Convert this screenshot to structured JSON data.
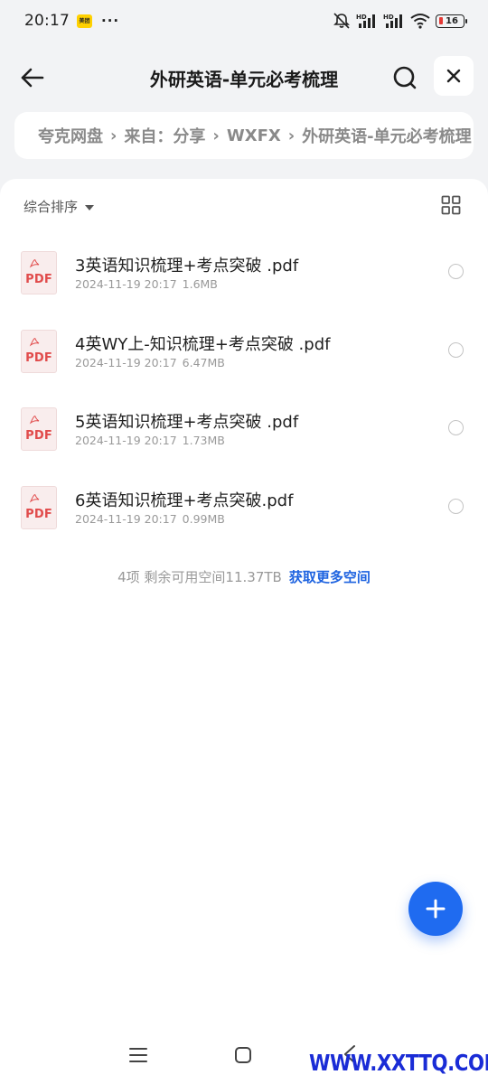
{
  "status_bar": {
    "time": "20:17",
    "app_badge": "美团",
    "more": "···",
    "battery": "16",
    "icons": [
      "mute-icon",
      "signal-hd-icon",
      "signal-hd-icon",
      "wifi-icon",
      "battery-icon"
    ]
  },
  "header": {
    "title": "外研英语-单元必考梳理",
    "back_icon": "arrow-left-icon",
    "search_icon": "search-icon",
    "close_icon": "close-icon"
  },
  "breadcrumb": {
    "items": [
      "夸克网盘",
      "来自：分享",
      "WXFX",
      "外研英语-单元必考梳理"
    ]
  },
  "toolbar": {
    "sort_label": "综合排序",
    "view_icon": "grid-view-icon"
  },
  "files": [
    {
      "name": "3英语知识梳理+考点突破 .pdf",
      "date": "2024-11-19 20:17",
      "size": "1.6MB",
      "type_label": "PDF"
    },
    {
      "name": "4英WY上-知识梳理+考点突破 .pdf",
      "date": "2024-11-19 20:17",
      "size": "6.47MB",
      "type_label": "PDF"
    },
    {
      "name": "5英语知识梳理+考点突破 .pdf",
      "date": "2024-11-19 20:17",
      "size": "1.73MB",
      "type_label": "PDF"
    },
    {
      "name": "6英语知识梳理+考点突破.pdf",
      "date": "2024-11-19 20:17",
      "size": "0.99MB",
      "type_label": "PDF"
    }
  ],
  "footer": {
    "summary": "4项 剩余可用空间11.37TB",
    "link": "获取更多空间"
  },
  "fab_icon": "plus-icon",
  "watermark": "WWW.XXTTQ.COM",
  "colors": {
    "accent": "#1f6bf0",
    "link": "#1e63e0",
    "pdf_red": "#e14b4b",
    "battery_low": "#e53935"
  }
}
